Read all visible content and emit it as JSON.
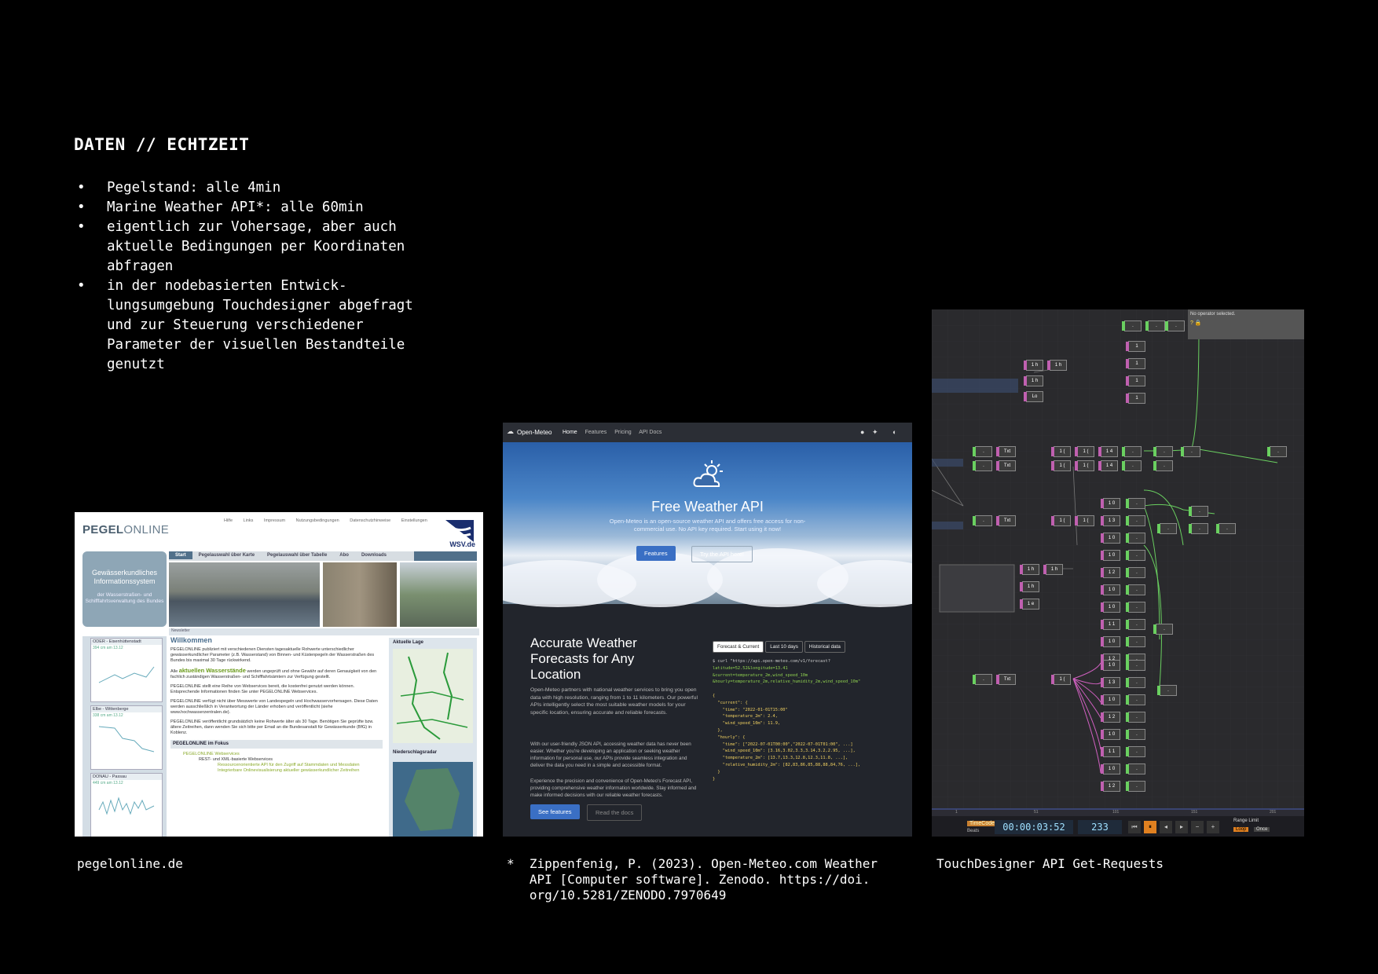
{
  "slide": {
    "title": "DATEN // ECHTZEIT",
    "bullets": [
      "Pegelstand: alle 4min",
      "Marine Weather API*: alle 60min",
      "eigentlich zur Vohersage, aber auch aktuelle Bedingungen per Koordinaten abfragen",
      "in der nodebasierten Entwick-lungsumgebung Touchdesigner abgefragt und zur Steuerung verschiedener Parameter der visuellen Bestandteile genutzt"
    ],
    "captions": {
      "pegel": "pegelonline.de",
      "meteo": "*  Zippenfenig, P. (2023). Open-Meteo.com Weather\n   API [Computer software]. Zenodo. https://doi.\n   org/10.5281/ZENODO.7970649",
      "td": "TouchDesigner API Get-Requests"
    }
  },
  "pegel": {
    "logo_a": "PEGEL",
    "logo_b": "ONLINE",
    "topnav": [
      "Hilfe",
      "Links",
      "Impressum",
      "Nutzungsbedingungen",
      "Datenschutzhinweise",
      "Einstellungen"
    ],
    "wsv": "WSV.de",
    "leftbox_title": "Gewässerkundliches Informationssystem",
    "leftbox_sub": "der Wasserstraßen- und Schifffahrtsverwaltung des Bundes",
    "tabs": [
      "Start",
      "Pegelauswahl über Karte",
      "Pegelauswahl über Tabelle",
      "Abo",
      "Downloads"
    ],
    "newsletter": "Newsletter",
    "welcome": "Willkommen",
    "para1": "PEGELONLINE publiziert mit verschiedenen Diensten tagesaktuelle Rohwerte unterschiedlicher gewässerkundlicher Parameter (z.B. Wasserstand) von Binnen- und Küstenpegeln der Wasserstraßen des Bundes bis maximal 30 Tage rückwirkend.",
    "para2a": "Alle",
    "para2b": "aktuellen Wasserstände",
    "para2c": "werden ungeprüft und ohne Gewähr auf deren Genauigkeit von den fachlich zuständigen Wasserstraßen- und Schifffahrtsämtern zur Verfügung gestellt.",
    "para3": "PEGELONLINE stellt eine Reihe von Webservices bereit, die kostenfrei genutzt werden können. Entsprechende Informationen finden Sie unter PEGELONLINE Webservices.",
    "para4": "PEGELONLINE verfügt nicht über Messwerte von Landespegeln und Hochwasservorhersagen. Diese Daten werden ausschließlich in Verantwortung der Länder erhoben und veröffentlicht (siehe www.hochwasserzentralen.de).",
    "para5": "PEGELONLINE veröffentlicht grundsätzlich keine Rohwerte älter als 30 Tage. Benötigen Sie geprüfte bzw. ältere Zeitreihen, dann wenden Sie sich bitte per Email an die Bundesanstalt für Gewässerkunde (BfG) in Koblenz.",
    "fokus": "PEGELONLINE im Fokus",
    "fokus_items": [
      "PEGELONLINE Webservices",
      "REST- und XML-basierte Webservices",
      "Ressourcenorientierte API für den Zugriff auf Stammdaten und Messdaten",
      "Integrierbare Onlinevisualisierung aktueller gewässerkundlicher Zeitreihen"
    ],
    "aktuelle_lage": "Aktuelle Lage",
    "niederschlag": "Niederschlagsradar",
    "gauges": [
      {
        "name": "ODER - Eisenhüttenstadt",
        "val": "394 cm am 13.12"
      },
      {
        "name": "Elbe - Wittenberge",
        "val": "338 cm am 13.12"
      },
      {
        "name": "DONAU - Passau",
        "val": "449 cm am 13.12"
      }
    ]
  },
  "meteo": {
    "brand": "Open-Meteo",
    "nav": [
      "Home",
      "Features",
      "Pricing",
      "API Docs"
    ],
    "hero_title": "Free Weather API",
    "hero_sub": "Open-Meteo is an open-source weather API and offers free access for non-commercial use. No API key required. Start using it now!",
    "btn_features": "Features",
    "btn_try": "Try the API here!",
    "h2": "Accurate Weather Forecasts for Any Location",
    "p1": "Open-Meteo partners with national weather services to bring you open data with high resolution, ranging from 1 to 11 kilometers. Our powerful APIs intelligently select the most suitable weather models for your specific location, ensuring accurate and reliable forecasts.",
    "p2": "With our user-friendly JSON API, accessing weather data has never been easier. Whether you're developing an application or seeking weather information for personal use, our APIs provide seamless integration and deliver the data you need in a simple and accessible format.",
    "p3": "Experience the precision and convenience of Open-Meteo's Forecast API, providing comprehensive weather information worldwide. Stay informed and make informed decisions with our reliable weather forecasts.",
    "btn_see": "See features",
    "btn_docs": "Read the docs",
    "ftabs": [
      "Forecast & Current",
      "Last 10 days",
      "Historical data"
    ],
    "code_cmd": "$ curl \"https://api.open-meteo.com/v1/forecast?",
    "code_lines": [
      "latitude=52.52&longitude=13.41",
      "&current=temperature_2m,wind_speed_10m",
      "&hourly=temperature_2m,relative_humidity_2m,wind_speed_10m\""
    ],
    "code_json": "{\n  \"current\": {\n    \"time\": \"2022-01-01T15:00\"\n    \"temperature_2m\": 2.4,\n    \"wind_speed_10m\": 11.9,\n  },\n  \"hourly\": {\n    \"time\": [\"2022-07-01T00:00\",\"2022-07-01T01:00\", ...]\n    \"wind_speed_10m\": [3.16,3.02,3.3,3.14,3.2,2.95, ...],\n    \"temperature_2m\": [13.7,13.3,12.8,12.3,11.8, ...],\n    \"relative_humidity_2m\": [82,83,86,85,88,88,84,76, ...],\n  }\n}"
  },
  "td": {
    "info": "No operator selected.",
    "info_icons": "? 🔒",
    "timecode": "00:00:03:52",
    "frame": "233",
    "tc_label": "TimeCode",
    "beats": "Beats",
    "range_limit": "Range Limit",
    "loop": "Loop",
    "once": "Once",
    "ticks": [
      "1",
      "51",
      "101",
      "151",
      "201"
    ]
  }
}
